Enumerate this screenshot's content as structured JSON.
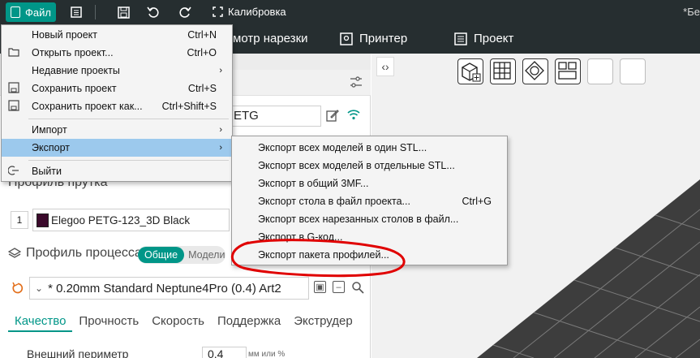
{
  "titlebar": {
    "file_label": "Файл",
    "calibration_label": "Калибровка",
    "right_text": "*Бе"
  },
  "tabs": [
    {
      "label": "мотр нарезки"
    },
    {
      "label": "Принтер"
    },
    {
      "label": "Проект"
    }
  ],
  "printer": {
    "value": "ETG"
  },
  "filament": {
    "index": "1",
    "name": "Elegoo PETG-123_3D Black",
    "color": "#3b0a2c"
  },
  "process": {
    "label": "Профиль процесса",
    "toggle_on": "Общие",
    "toggle_off": "Модели",
    "preset": "* 0.20mm Standard Neptune4Pro (0.4) Art2"
  },
  "settings_tabs": [
    {
      "label": "Качество",
      "active": true
    },
    {
      "label": "Прочность",
      "active": false
    },
    {
      "label": "Скорость",
      "active": false
    },
    {
      "label": "Поддержка",
      "active": false
    },
    {
      "label": "Экструдер",
      "active": false
    }
  ],
  "obscured": {
    "filament_header": "Профиль прутка"
  },
  "outer_perimeter": {
    "label": "Внешний периметр",
    "value": "0.4",
    "unit": "мм или %"
  },
  "file_menu": {
    "items": [
      {
        "label": "Новый проект",
        "shortcut": "Ctrl+N"
      },
      {
        "label": "Открыть проект...",
        "shortcut": "Ctrl+O"
      },
      {
        "label": "Недавние проекты",
        "shortcut": ""
      },
      {
        "label": "Сохранить проект",
        "shortcut": "Ctrl+S"
      },
      {
        "label": "Сохранить проект как...",
        "shortcut": "Ctrl+Shift+S"
      },
      {
        "label": "Импорт",
        "shortcut": ""
      },
      {
        "label": "Экспорт",
        "shortcut": ""
      },
      {
        "label": "Выйти",
        "shortcut": ""
      }
    ]
  },
  "export_menu": {
    "items": [
      {
        "label": "Экспорт всех моделей в один STL...",
        "shortcut": ""
      },
      {
        "label": "Экспорт всех моделей в отдельные STL...",
        "shortcut": ""
      },
      {
        "label": "Экспорт в общий 3MF...",
        "shortcut": ""
      },
      {
        "label": "Экспорт стола в файл проекта...",
        "shortcut": "Ctrl+G"
      },
      {
        "label": "Экспорт всех нарезанных столов в файл...",
        "shortcut": ""
      },
      {
        "label": "Экспорт в G-код...",
        "shortcut": ""
      },
      {
        "label": "Экспорт пакета профилей...",
        "shortcut": ""
      }
    ]
  },
  "colors": {
    "accent": "#009688",
    "titlebar": "#262e30",
    "menu_highlight": "#9cc9ed",
    "annotation": "#e00000"
  },
  "icons": {
    "menu": "hamburger-icon",
    "save": "save-icon",
    "undo": "undo-icon",
    "redo": "redo-icon",
    "calibration": "calibration-icon"
  }
}
